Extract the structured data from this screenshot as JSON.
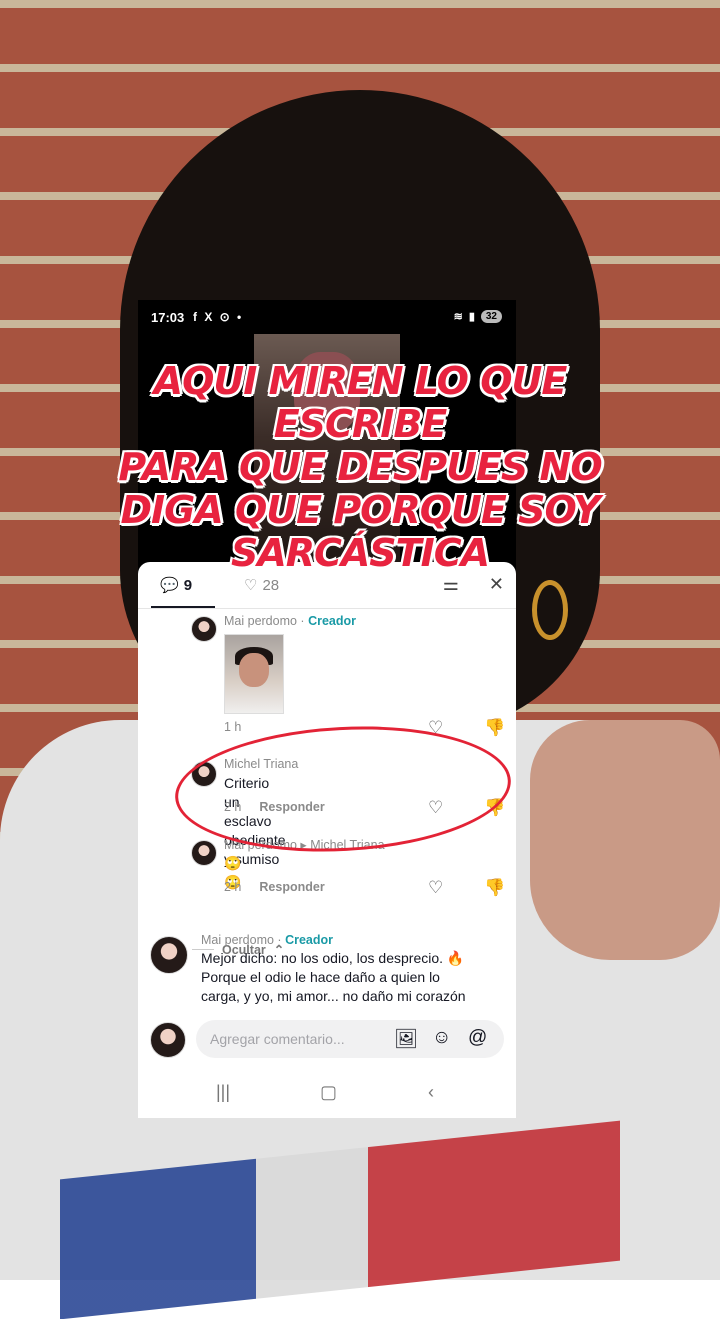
{
  "status_bar": {
    "time": "17:03",
    "app_icons": "f X ⊙ •",
    "battery": "32"
  },
  "overlay_text": {
    "line1": "AQUI MIREN LO QUE",
    "line2": "ESCRIBE",
    "line3": "PARA QUE DESPUES NO",
    "line4": "DIGA QUE PORQUE SOY",
    "line5": "SARCÁSTICA"
  },
  "tabs": {
    "comments_count": "9",
    "likes_count": "28"
  },
  "comments": [
    {
      "author": "Mai perdomo",
      "badge": "Creador",
      "time": "1 h"
    },
    {
      "author": "Michel Triana",
      "text": "Criterio un esclavo obediente y sumiso",
      "time": "2 h",
      "reply_label": "Responder"
    },
    {
      "author": "Mai perdomo",
      "reply_to": "Michel Triana",
      "text": "🙄🙄",
      "time": "2 h",
      "reply_label": "Responder"
    },
    {
      "author": "Mai perdomo",
      "badge": "Creador",
      "text_line1": "Mejor dicho: no los odio, los desprecio. 🔥",
      "text_line2": "Porque el odio le hace daño a quien lo",
      "text_line3": "carga, y yo, mi amor... no daño mi corazón"
    }
  ],
  "hide_label": "Ocultar",
  "input": {
    "placeholder": "Agregar comentario..."
  },
  "icons": [
    "comment-icon",
    "heart-icon",
    "filter-icon",
    "close-icon",
    "like-icon",
    "dislike-icon",
    "image-icon",
    "emoji-icon",
    "mention-icon"
  ]
}
